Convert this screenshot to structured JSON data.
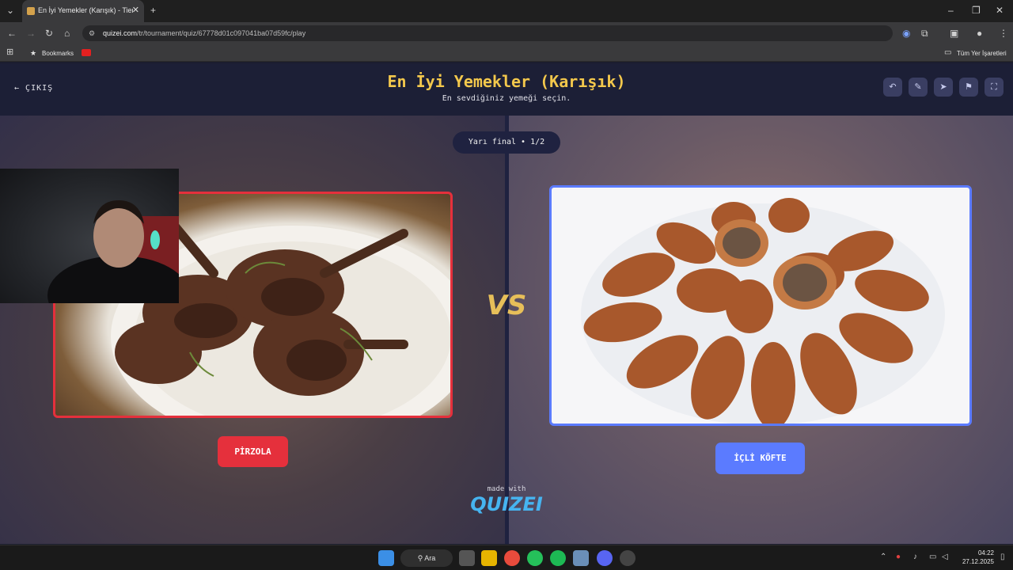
{
  "browser": {
    "tab_title": "En İyi Yemekler (Karışık) - Tier L",
    "url_host": "quizei.com",
    "url_path": "/tr/tournament/quiz/67778d01c097041ba07d59fc/play",
    "bookmarks_label": "Bookmarks",
    "all_bookmarks_label": "Tüm Yer İşaretleri"
  },
  "header": {
    "exit_label": "ÇIKIŞ",
    "title": "En İyi Yemekler (Karışık)",
    "subtitle": "En sevdiğiniz yemeği seçin."
  },
  "match": {
    "round_label": "Yarı final • 1/2",
    "vs_label": "VS",
    "left_option": "PİRZOLA",
    "right_option": "İÇLİ KÖFTE"
  },
  "footer": {
    "made_with": "made with",
    "logo_text": "QUIZEI"
  },
  "taskbar": {
    "search_label": "Ara",
    "time": "04:22",
    "date": "27.12.2025"
  },
  "colors": {
    "title": "#f3c84c",
    "left_accent": "#e5303c",
    "right_accent": "#5b7bff",
    "header_bg": "#1c1f36"
  },
  "icons": [
    "undo-icon",
    "edit-icon",
    "share-icon",
    "flag-icon",
    "fullscreen-icon"
  ]
}
